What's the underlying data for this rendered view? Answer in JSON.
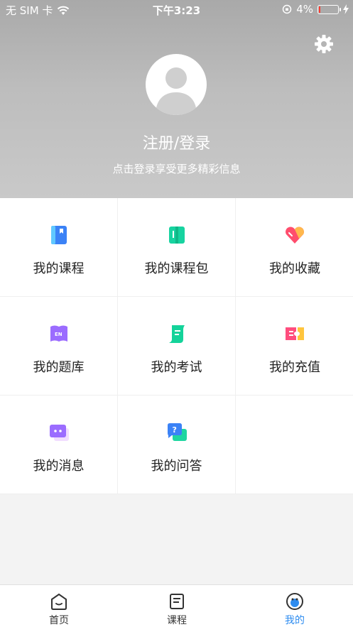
{
  "status_bar": {
    "carrier": "无 SIM 卡",
    "time": "下午3:23",
    "battery": "4%"
  },
  "header": {
    "login_title": "注册/登录",
    "login_subtitle": "点击登录享受更多精彩信息",
    "settings_icon": "gear-icon"
  },
  "grid": {
    "items": [
      {
        "label": "我的课程",
        "icon": "book-icon"
      },
      {
        "label": "我的课程包",
        "icon": "course-pack-icon"
      },
      {
        "label": "我的收藏",
        "icon": "heart-icon"
      },
      {
        "label": "我的题库",
        "icon": "question-bank-icon"
      },
      {
        "label": "我的考试",
        "icon": "exam-scroll-icon"
      },
      {
        "label": "我的充值",
        "icon": "ticket-icon"
      },
      {
        "label": "我的消息",
        "icon": "message-icon"
      },
      {
        "label": "我的问答",
        "icon": "qa-icon"
      }
    ]
  },
  "tabbar": {
    "tabs": [
      {
        "label": "首页",
        "icon": "home-icon",
        "active": false
      },
      {
        "label": "课程",
        "icon": "course-list-icon",
        "active": false
      },
      {
        "label": "我的",
        "icon": "profile-face-icon",
        "active": true
      }
    ]
  },
  "colors": {
    "accent": "#2d8cf0",
    "header_gray": "#bdbdbd"
  }
}
